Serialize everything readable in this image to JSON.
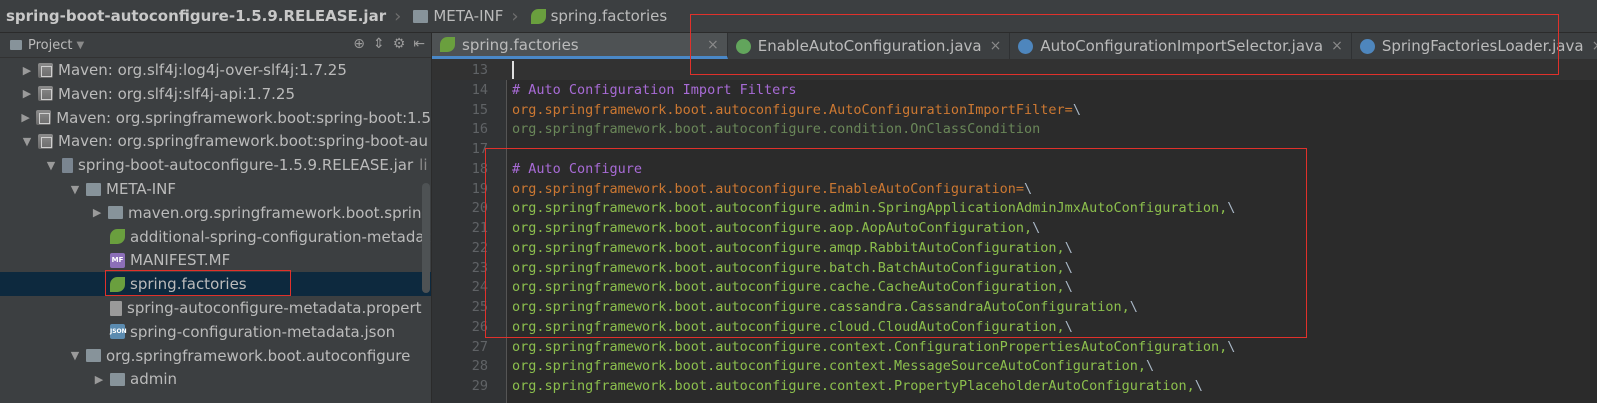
{
  "breadcrumb": {
    "jar": "spring-boot-autoconfigure-1.5.9.RELEASE.jar",
    "folder": "META-INF",
    "file": "spring.factories"
  },
  "project_pane": {
    "title": "Project",
    "tree": [
      {
        "label": "Maven: org.slf4j:log4j-over-slf4j:1.7.25",
        "icon": "maven-library-icon",
        "expanded": false
      },
      {
        "label": "Maven: org.slf4j:slf4j-api:1.7.25",
        "icon": "maven-library-icon",
        "expanded": false
      },
      {
        "label": "Maven: org.springframework.boot:spring-boot:1.5",
        "icon": "maven-library-icon",
        "expanded": false
      },
      {
        "label": "Maven: org.springframework.boot:spring-boot-au",
        "icon": "maven-library-icon",
        "expanded": true
      },
      {
        "label": "spring-boot-autoconfigure-1.5.9.RELEASE.jar",
        "suffix": "li",
        "icon": "jar-icon",
        "expanded": true
      },
      {
        "label": "META-INF",
        "icon": "folder-icon",
        "expanded": true
      },
      {
        "label": "maven.org.springframework.boot.spring",
        "icon": "folder-icon",
        "expanded": false
      },
      {
        "label": "additional-spring-configuration-metadat",
        "icon": "spring-json-icon"
      },
      {
        "label": "MANIFEST.MF",
        "icon": "manifest-icon"
      },
      {
        "label": "spring.factories",
        "icon": "spring-factories-icon",
        "selected": true
      },
      {
        "label": "spring-autoconfigure-metadata.propert",
        "icon": "properties-icon"
      },
      {
        "label": "spring-configuration-metadata.json",
        "icon": "json-icon"
      },
      {
        "label": "org.springframework.boot.autoconfigure",
        "icon": "package-icon",
        "expanded": true
      },
      {
        "label": "admin",
        "icon": "package-icon",
        "expanded": false
      }
    ]
  },
  "tabs": [
    {
      "label": "spring.factories",
      "active": true,
      "icon": "spring-factories-icon"
    },
    {
      "label": "EnableAutoConfiguration.java",
      "active": false,
      "icon": "annotation-icon"
    },
    {
      "label": "AutoConfigurationImportSelector.java",
      "active": false,
      "icon": "class-icon"
    },
    {
      "label": "SpringFactoriesLoader.java",
      "active": false,
      "icon": "class-icon"
    }
  ],
  "editor": {
    "lines": [
      {
        "num": "13",
        "text": "",
        "kind": "blank"
      },
      {
        "num": "14",
        "text": "# Auto Configuration Import Filters",
        "kind": "comment"
      },
      {
        "num": "15",
        "text": "org.springframework.boot.autoconfigure.AutoConfigurationImportFilter=",
        "tail": "\\",
        "kind": "key"
      },
      {
        "num": "16",
        "text": "org.springframework.boot.autoconfigure.condition.OnClassCondition",
        "kind": "val"
      },
      {
        "num": "17",
        "text": "",
        "kind": "blank"
      },
      {
        "num": "18",
        "text": "# Auto Configure",
        "kind": "comment"
      },
      {
        "num": "19",
        "text": "org.springframework.boot.autoconfigure.EnableAutoConfiguration=",
        "tail": "\\",
        "kind": "key"
      },
      {
        "num": "20",
        "text": "org.springframework.boot.autoconfigure.admin.SpringApplicationAdminJmxAutoConfiguration,",
        "tail": "\\",
        "kind": "cont"
      },
      {
        "num": "21",
        "text": "org.springframework.boot.autoconfigure.aop.AopAutoConfiguration,",
        "tail": "\\",
        "kind": "cont"
      },
      {
        "num": "22",
        "text": "org.springframework.boot.autoconfigure.amqp.RabbitAutoConfiguration,",
        "tail": "\\",
        "kind": "cont"
      },
      {
        "num": "23",
        "text": "org.springframework.boot.autoconfigure.batch.BatchAutoConfiguration,",
        "tail": "\\",
        "kind": "cont"
      },
      {
        "num": "24",
        "text": "org.springframework.boot.autoconfigure.cache.CacheAutoConfiguration,",
        "tail": "\\",
        "kind": "cont"
      },
      {
        "num": "25",
        "text": "org.springframework.boot.autoconfigure.cassandra.CassandraAutoConfiguration,",
        "tail": "\\",
        "kind": "cont"
      },
      {
        "num": "26",
        "text": "org.springframework.boot.autoconfigure.cloud.CloudAutoConfiguration,",
        "tail": "\\",
        "kind": "cont"
      },
      {
        "num": "27",
        "text": "org.springframework.boot.autoconfigure.context.ConfigurationPropertiesAutoConfiguration,",
        "tail": "\\",
        "kind": "cont"
      },
      {
        "num": "28",
        "text": "org.springframework.boot.autoconfigure.context.MessageSourceAutoConfiguration,",
        "tail": "\\",
        "kind": "cont"
      },
      {
        "num": "29",
        "text": "org.springframework.boot.autoconfigure.context.PropertyPlaceholderAutoConfiguration,",
        "tail": "\\",
        "kind": "cont"
      }
    ]
  },
  "colors": {
    "comment": "#a86bd6",
    "key": "#cc7832",
    "value": "#8cbf4d",
    "highlight_box": "#e0312b",
    "selection": "#0d293e"
  }
}
